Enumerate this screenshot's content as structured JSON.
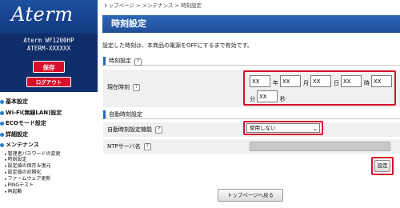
{
  "sidebar": {
    "logo": "Aterm",
    "model_name": "Aterm WF1200HP",
    "model_id": "ATERM-XXXXXX",
    "save_label": "保存",
    "logout_label": "ログアウト",
    "menu": [
      {
        "label": "基本設定"
      },
      {
        "label": "Wi-Fi(無線LAN)設定"
      },
      {
        "label": "ECOモード設定"
      },
      {
        "label": "詳細設定"
      },
      {
        "label": "メンテナンス"
      }
    ],
    "maintenance_items": [
      "管理者パスワードの変更",
      "時刻設定",
      "設定値の保存＆復元",
      "設定値の初期化",
      "ファームウェア更新",
      "PINGテスト",
      "再起動"
    ]
  },
  "breadcrumb": {
    "home": "トップページ",
    "sep": ">",
    "parent": "メンテナンス",
    "current": "時刻設定"
  },
  "page": {
    "title": "時刻設定",
    "description": "設定した時刻は、本商品の電源をOFFにするまで有効です。"
  },
  "time_section": {
    "heading": "時刻設定",
    "help": "?",
    "current_time_label": "現在時刻",
    "year": {
      "value": "XX",
      "unit": "年"
    },
    "month": {
      "value": "XX",
      "unit": "月"
    },
    "day": {
      "value": "XX",
      "unit": "日"
    },
    "hour": {
      "value": "XX",
      "unit": "時"
    },
    "minute": {
      "value": "XX",
      "unit": "分"
    },
    "second": {
      "value": "XX",
      "unit": "秒"
    }
  },
  "auto_section": {
    "heading": "自動時刻設定",
    "auto_label": "自動時刻設定機能",
    "auto_value": "使用しない",
    "ntp_label": "NTPサーバ名",
    "ntp_value": ""
  },
  "buttons": {
    "set_label": "設定",
    "top_label": "トップページへ戻る"
  },
  "colors": {
    "title_bar": "#2b66b8",
    "sidebar_dark": "#102e6a",
    "accent_red": "#d8102b",
    "row_bg": "#f0f0f0"
  }
}
